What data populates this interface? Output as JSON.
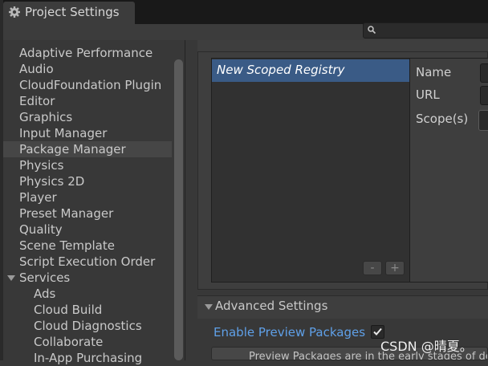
{
  "window": {
    "title": "Project Settings"
  },
  "sidebar": {
    "items": [
      {
        "label": "Adaptive Performance",
        "selected": false,
        "level": 0
      },
      {
        "label": "Audio",
        "selected": false,
        "level": 0
      },
      {
        "label": "CloudFoundation Plugin",
        "selected": false,
        "level": 0
      },
      {
        "label": "Editor",
        "selected": false,
        "level": 0
      },
      {
        "label": "Graphics",
        "selected": false,
        "level": 0
      },
      {
        "label": "Input Manager",
        "selected": false,
        "level": 0
      },
      {
        "label": "Package Manager",
        "selected": true,
        "level": 0
      },
      {
        "label": "Physics",
        "selected": false,
        "level": 0
      },
      {
        "label": "Physics 2D",
        "selected": false,
        "level": 0
      },
      {
        "label": "Player",
        "selected": false,
        "level": 0
      },
      {
        "label": "Preset Manager",
        "selected": false,
        "level": 0
      },
      {
        "label": "Quality",
        "selected": false,
        "level": 0
      },
      {
        "label": "Scene Template",
        "selected": false,
        "level": 0
      },
      {
        "label": "Script Execution Order",
        "selected": false,
        "level": 0
      },
      {
        "label": "Services",
        "selected": false,
        "level": 0,
        "expanded": true
      },
      {
        "label": "Ads",
        "selected": false,
        "level": 1
      },
      {
        "label": "Cloud Build",
        "selected": false,
        "level": 1
      },
      {
        "label": "Cloud Diagnostics",
        "selected": false,
        "level": 1
      },
      {
        "label": "Collaborate",
        "selected": false,
        "level": 1
      },
      {
        "label": "In-App Purchasing",
        "selected": false,
        "level": 1
      }
    ]
  },
  "registries": {
    "items": [
      {
        "label": "New Scoped Registry",
        "selected": true
      }
    ],
    "remove_label": "-",
    "add_label": "+"
  },
  "registry_detail": {
    "name_label": "Name",
    "url_label": "URL",
    "scopes_label": "Scope(s)"
  },
  "advanced": {
    "title": "Advanced Settings",
    "enable_preview_label": "Enable Preview Packages",
    "enable_preview_checked": true,
    "preview_info": "Preview Packages are in the early stages of de"
  },
  "watermark": "CSDN @晴夏。",
  "colors": {
    "selection": "#3a5b86",
    "link_text": "#5fa0e8",
    "background": "#383838",
    "title_bar": "#191919"
  },
  "icons": {
    "tab": "gear-icon",
    "search": "search-icon",
    "checkbox": "checkmark-icon",
    "foldout": "triangle-down-icon"
  }
}
